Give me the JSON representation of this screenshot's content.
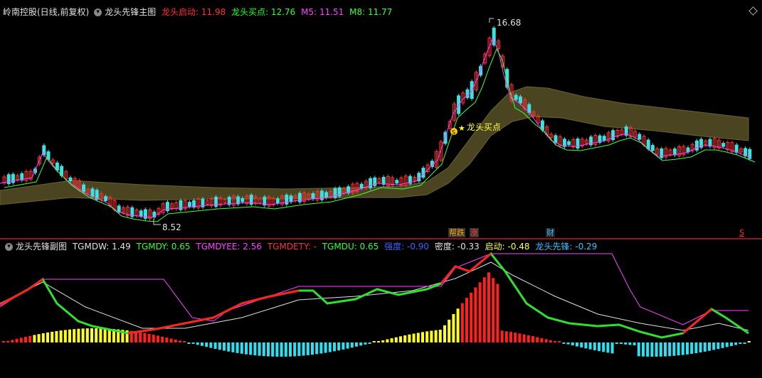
{
  "main": {
    "stock_name": "岭南控股(日线,前复权)",
    "indicator_name": "龙头先锋主图",
    "values": [
      {
        "label": "龙头启动: 11.98",
        "color": "#ff3030"
      },
      {
        "label": "龙头买点: 12.76",
        "color": "#30ff30"
      },
      {
        "label": "M5: 11.51",
        "color": "#ff40ff"
      },
      {
        "label": "M8: 11.77",
        "color": "#40ff40"
      }
    ],
    "high_label": "16.68",
    "low_label": "8.52",
    "buy_point_label": "龙头买点",
    "buy_point_badge": "S",
    "bottom_tags": [
      {
        "text": "帮跌",
        "color": "#ffaa00",
        "bg": "#333333"
      },
      {
        "text": "涨",
        "color": "#ff4040",
        "bg": "#333333"
      },
      {
        "text": "财",
        "color": "#40c0ff",
        "bg": "#222222"
      },
      {
        "text": "S",
        "color": "#ff3030",
        "bg": "#000000"
      }
    ]
  },
  "sub": {
    "indicator_name": "龙头先锋副图",
    "values": [
      {
        "label": "TGMDW: 1.49",
        "color": "#e0e0e0"
      },
      {
        "label": "TGMDY: 0.65",
        "color": "#30ff30"
      },
      {
        "label": "TGMDYEE: 2.56",
        "color": "#ff40ff"
      },
      {
        "label": "TGMDETY: -",
        "color": "#ff3030"
      },
      {
        "label": "TGMDU: 0.65",
        "color": "#30ff30"
      },
      {
        "label": "强度: -0.90",
        "color": "#4060ff"
      },
      {
        "label": "密度: -0.33",
        "color": "#e0e0e0"
      },
      {
        "label": "启动: -0.48",
        "color": "#ffff40"
      },
      {
        "label": "龙头先锋: -0.29",
        "color": "#40c0ff"
      }
    ]
  },
  "chart_data": {
    "type": "candlestick",
    "price_low": 8.52,
    "price_high": 16.68,
    "ma_series": [
      "M5",
      "M8"
    ],
    "sub_series": [
      "TGMDW",
      "TGMDY",
      "TGMDYEE",
      "TGMDETY",
      "TGMDU",
      "强度",
      "密度",
      "启动",
      "龙头先锋"
    ]
  }
}
